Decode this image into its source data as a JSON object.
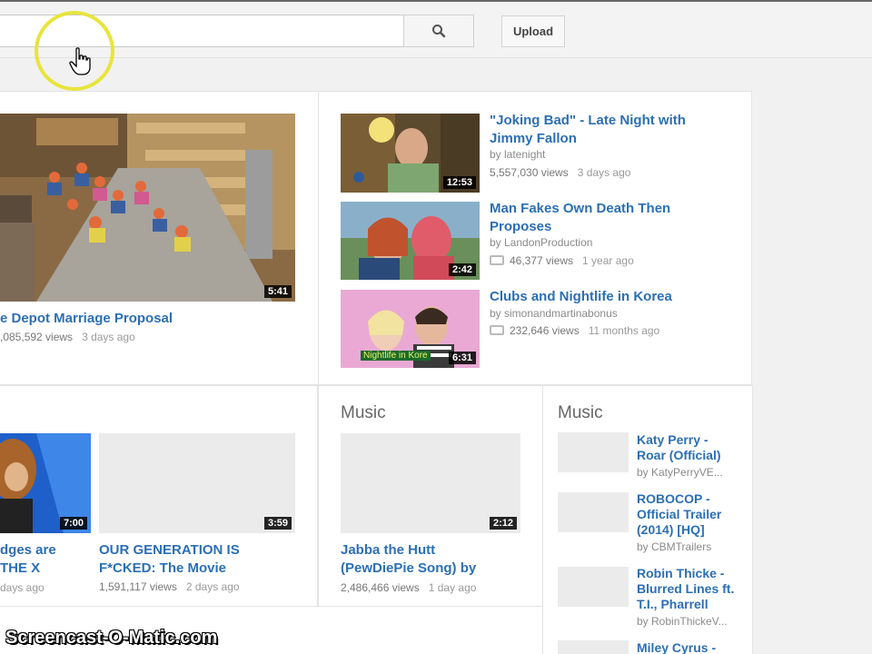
{
  "header": {
    "search": {
      "value": "",
      "placeholder": ""
    },
    "upload_label": "Upload"
  },
  "featured": {
    "title": "e Depot Marriage Proposal",
    "views": ",085,592 views",
    "ago": "3 days ago",
    "duration": "5:41"
  },
  "recommended": [
    {
      "title": "\"Joking Bad\" - Late Night with Jimmy Fallon",
      "by": "by latenight",
      "views": "5,557,030 views",
      "ago": "3 days ago",
      "duration": "12:53"
    },
    {
      "title": "Man Fakes Own Death Then Proposes",
      "by": "by LandonProduction",
      "views": "46,377 views",
      "ago": "1 year ago",
      "duration": "2:42"
    },
    {
      "title": "Clubs and Nightlife in Korea",
      "by": "by simonandmartinabonus",
      "views": "232,646 views",
      "ago": "11 months ago",
      "duration": "6:31",
      "overlay": "Nightlife in Kore"
    }
  ],
  "row2": [
    {
      "title_line1": "dges are",
      "title_line2": "THE X",
      "ago": "days ago",
      "duration": "7:00"
    },
    {
      "title_line1": "OUR GENERATION IS",
      "title_line2": "F*CKED: The Movie",
      "views": "1,591,117 views",
      "ago": "2 days ago",
      "duration": "3:59"
    }
  ],
  "music_card": {
    "heading": "Music",
    "title_line1": "Jabba the Hutt",
    "title_line2": "(PewDiePie Song) by",
    "views": "2,486,466 views",
    "ago": "1 day ago",
    "duration": "2:12"
  },
  "music_list": {
    "heading": "Music",
    "items": [
      {
        "title": "Katy Perry - Roar (Official)",
        "by": "by KatyPerryVE..."
      },
      {
        "title": "ROBOCOP - Official Trailer (2014) [HQ]",
        "by": "by CBMTrailers"
      },
      {
        "title": "Robin Thicke - Blurred Lines ft. T.I., Pharrell",
        "by": "by RobinThickeV..."
      },
      {
        "title": "Miley Cyrus -",
        "by": ""
      }
    ]
  },
  "watermark": "Screencast-O-Matic.com"
}
